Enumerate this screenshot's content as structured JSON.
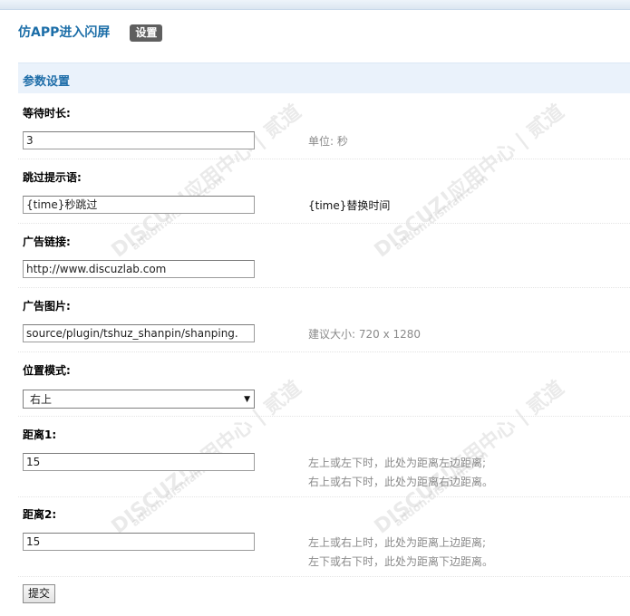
{
  "header": {
    "title": "仿APP进入闪屏",
    "settings_tab": "设置"
  },
  "section": {
    "title": "参数设置"
  },
  "fields": {
    "wait_time": {
      "label": "等待时长:",
      "value": "3",
      "hint": "单位: 秒"
    },
    "skip_text": {
      "label": "跳过提示语:",
      "value": "{time}秒跳过",
      "hint": "{time}替换时间"
    },
    "ad_link": {
      "label": "广告链接:",
      "value": "http://www.discuzlab.com"
    },
    "ad_image": {
      "label": "广告图片:",
      "value": "source/plugin/tshuz_shanpin/shanping.",
      "hint": "建议大小: 720 x 1280"
    },
    "position_mode": {
      "label": "位置模式:",
      "value": "右上"
    },
    "distance1": {
      "label": "距离1:",
      "value": "15",
      "hint_line1": "左上或左下时，此处为距离左边距离;",
      "hint_line2": "右上或右下时，此处为距离右边距离。"
    },
    "distance2": {
      "label": "距离2:",
      "value": "15",
      "hint_line1": "左上或右上时，此处为距离上边距离;",
      "hint_line2": "左下或右下时，此处为距离下边距离。"
    }
  },
  "submit_label": "提交",
  "watermark": {
    "big": "DISCUZ!应用中心 | 贰道",
    "small": "addon.dismall.com"
  },
  "icons": {
    "select_arrow": "chevron-down-icon"
  }
}
